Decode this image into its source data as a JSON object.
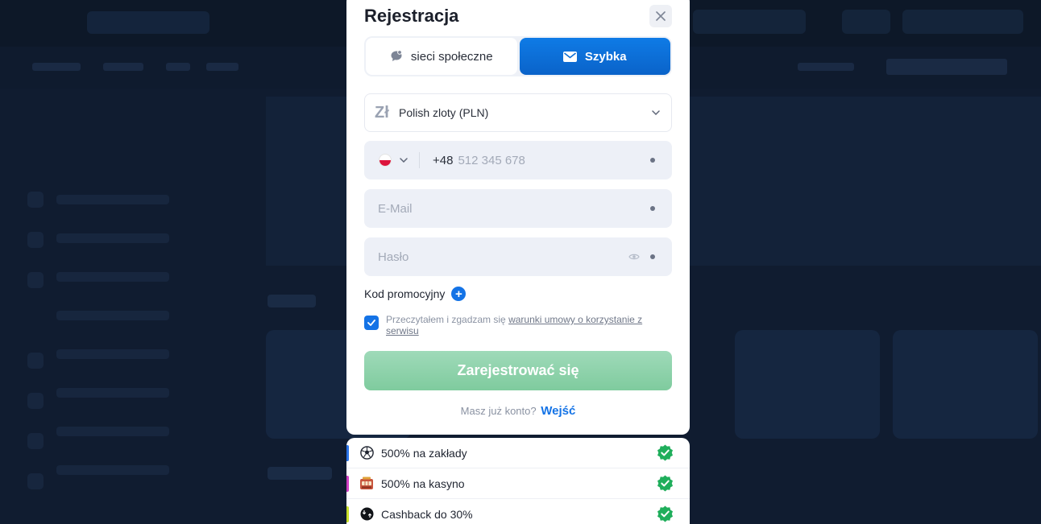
{
  "modal": {
    "title": "Rejestracja",
    "tabs": [
      {
        "label": "sieci społeczne",
        "icon": "chat-bubble-icon"
      },
      {
        "label": "Szybka",
        "icon": "envelope-icon"
      }
    ],
    "currency": {
      "symbol": "Zł",
      "value": "Polish zloty (PLN)"
    },
    "phone": {
      "prefix": "+48",
      "placeholder": "512 345 678",
      "flag": "poland-flag-icon"
    },
    "email": {
      "placeholder": "E-Mail"
    },
    "password": {
      "placeholder": "Hasło"
    },
    "promo_label": "Kod promocyjny",
    "promo_plus": "+",
    "agree": {
      "text": "Przeczytałem i zgadzam się ",
      "link": "warunki umowy o korzystanie z serwisu",
      "checked": true
    },
    "submit_label": "Zarejestrować się",
    "login": {
      "text": "Masz już konto?",
      "link": "Wejść"
    }
  },
  "bonuses": [
    {
      "label": "500% na zakłady",
      "icon": "soccer-ball-icon",
      "color": "#2a73e8"
    },
    {
      "label": "500% na kasyno",
      "icon": "slot-machine-icon",
      "color": "#d03fc4"
    },
    {
      "label": "Cashback do 30%",
      "icon": "cashback-icon",
      "color": "#c9e02a"
    }
  ],
  "colors": {
    "primary": "#1473e6",
    "submit": "#8fd3ab",
    "check": "#1fae5b",
    "overlay": "#101c30"
  }
}
